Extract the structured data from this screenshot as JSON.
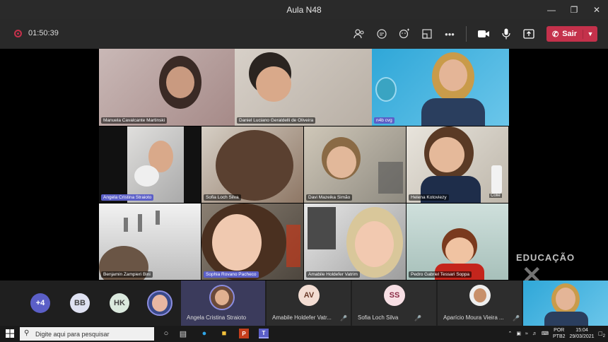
{
  "window": {
    "title": "Aula N48"
  },
  "toolbar": {
    "timer": "01:50:39",
    "icons": [
      "people-icon",
      "chat-icon",
      "reactions-icon",
      "rooms-icon",
      "more-icon"
    ],
    "leave_label": "Sair"
  },
  "stage": {
    "tiles": [
      {
        "name": "Manuela Cavalcante Martinski"
      },
      {
        "name": "Daniel Luciano Geraldelli de Oliveira"
      },
      {
        "name": "n4b cvg"
      },
      {
        "name": "Angela Cristina Straioto"
      },
      {
        "name": "Sofia Loch Silva"
      },
      {
        "name": "Davi Mazeika Simão"
      },
      {
        "name": "Helena Kotoviezy"
      },
      {
        "name": "Benjamin Zampieri Bini"
      },
      {
        "name": "Sophia Rovano Pacheco"
      },
      {
        "name": "Amabile Holdefer Vatrim"
      },
      {
        "name": "Pedro Gabriel Tessari Soppa"
      }
    ],
    "colie_label": "Colie",
    "watermark_text": "EDUCAÇÃO"
  },
  "strip": {
    "more_count": "+4",
    "avatars": [
      "BB",
      "HK"
    ],
    "participants": [
      {
        "initials": "",
        "name": "Angela Cristina Straioto"
      },
      {
        "initials": "AV",
        "name": "Amabile Holdefer Vatr..."
      },
      {
        "initials": "SS",
        "name": "Sofia Loch Silva"
      },
      {
        "initials": "",
        "name": "Aparício Moura Vieira ..."
      }
    ]
  },
  "taskbar": {
    "search_placeholder": "Digite aqui para pesquisar",
    "lang_top": "POR",
    "lang_bottom": "PTB2",
    "time": "15:04",
    "date": "29/03/2021",
    "notif_count": "2"
  }
}
